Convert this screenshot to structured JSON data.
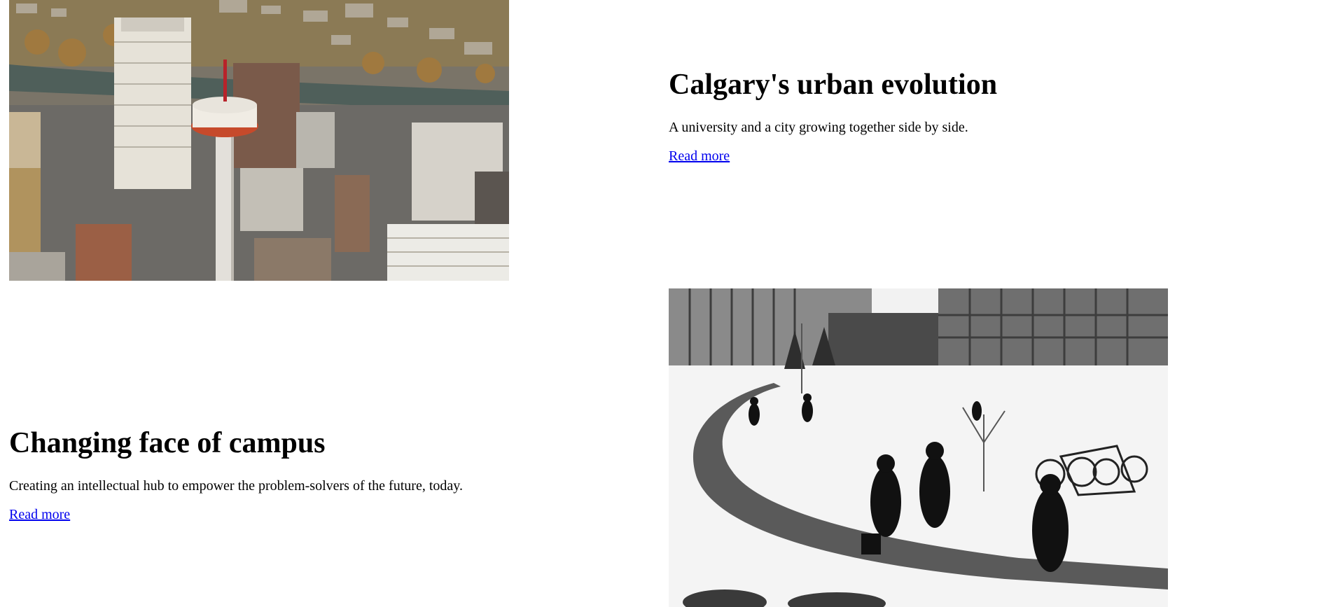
{
  "features": [
    {
      "title": "Calgary's urban evolution",
      "description": "A university and a city growing together side by side.",
      "link_label": "Read more",
      "image_alt": "Aerial view of downtown Calgary with Calgary Tower"
    },
    {
      "title": "Changing face of campus",
      "description": "Creating an intellectual hub to empower the problem-solvers of the future, today.",
      "link_label": "Read more",
      "image_alt": "Black and white photo of students walking on a snowy campus"
    }
  ]
}
